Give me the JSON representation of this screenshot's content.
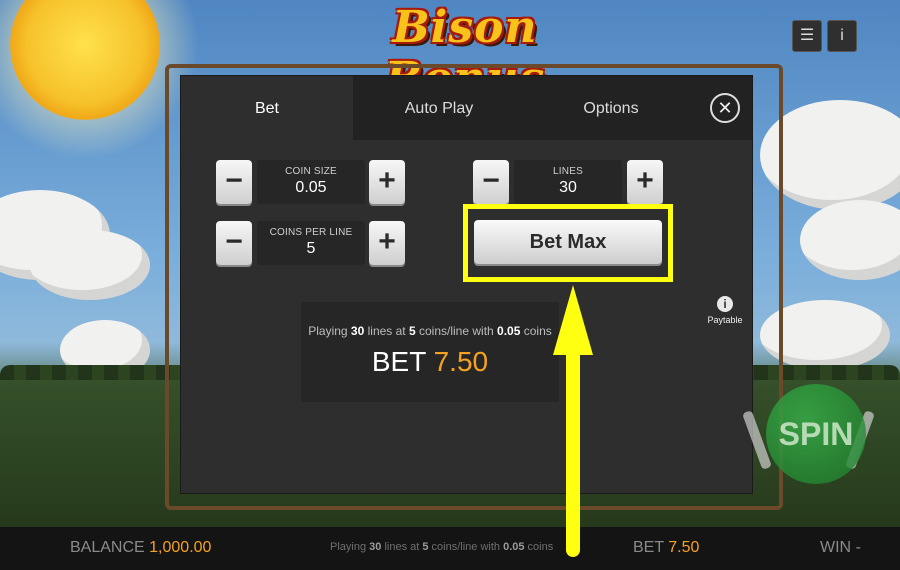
{
  "game": {
    "title": "Bison Bonus"
  },
  "corner_buttons": {
    "menu_icon": "menu-icon",
    "info_icon": "info-icon",
    "menu_glyph": "☰",
    "info_glyph": "i"
  },
  "tabs": [
    {
      "label": "Bet",
      "active": true
    },
    {
      "label": "Auto Play",
      "active": false
    },
    {
      "label": "Options",
      "active": false
    }
  ],
  "close_glyph": "✕",
  "bet_controls": {
    "coin_size": {
      "label": "COIN SIZE",
      "value": "0.05"
    },
    "coins_per_line": {
      "label": "COINS PER LINE",
      "value": "5"
    },
    "lines": {
      "label": "LINES",
      "value": "30"
    },
    "minus_glyph": "−",
    "plus_glyph": "+"
  },
  "bet_max": {
    "label": "Bet Max",
    "highlight_color": "#ffff11"
  },
  "summary": {
    "playing_prefix": "Playing ",
    "lines": "30",
    "lines_mid": " lines at ",
    "coins": "5",
    "coins_mid": " coins/line with ",
    "coin_size": "0.05",
    "suffix": " coins",
    "bet_label": "BET ",
    "bet_amount": "7.50"
  },
  "paytable": {
    "label": "Paytable",
    "glyph": "i"
  },
  "spin": {
    "label": "SPIN"
  },
  "bottom_bar": {
    "balance_label": "BALANCE",
    "balance_value": "1,000.00",
    "playing_prefix": "Playing ",
    "lines": "30",
    "lines_mid": " lines at ",
    "coins": "5",
    "coins_mid": " coins/line with ",
    "coin_size": "0.05",
    "suffix": " coins",
    "bet_label": "BET",
    "bet_value": "7.50",
    "win_label": "WIN",
    "win_value": "-"
  },
  "colors": {
    "accent": "#f6a21e",
    "annotation": "#ffff11",
    "panel": "#2e2e2e"
  }
}
